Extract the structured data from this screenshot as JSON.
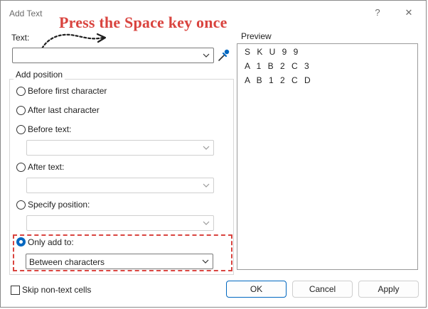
{
  "window": {
    "title": "Add Text",
    "help_glyph": "?",
    "close_glyph": "✕"
  },
  "annotation": {
    "text": "Press the Space key once",
    "color": "#d9443f"
  },
  "text_field": {
    "label": "Text:",
    "value": ""
  },
  "add_position": {
    "label": "Add position",
    "options": [
      {
        "label": "Before first character",
        "selected": false
      },
      {
        "label": "After last character",
        "selected": false
      },
      {
        "label": "Before text:",
        "selected": false,
        "value": ""
      },
      {
        "label": "After text:",
        "selected": false,
        "value": ""
      },
      {
        "label": "Specify position:",
        "selected": false,
        "value": ""
      },
      {
        "label": "Only add to:",
        "selected": true,
        "value": "Between characters"
      }
    ]
  },
  "preview": {
    "label": "Preview",
    "lines": [
      "S K U 9 9",
      "A 1 B 2 C 3",
      "A B 1 2 C D"
    ]
  },
  "skip_non_text": {
    "label": "Skip non-text cells",
    "checked": false
  },
  "buttons": {
    "ok": "OK",
    "cancel": "Cancel",
    "apply": "Apply"
  },
  "colors": {
    "accent": "#0067c0",
    "highlight": "#d9443f"
  }
}
